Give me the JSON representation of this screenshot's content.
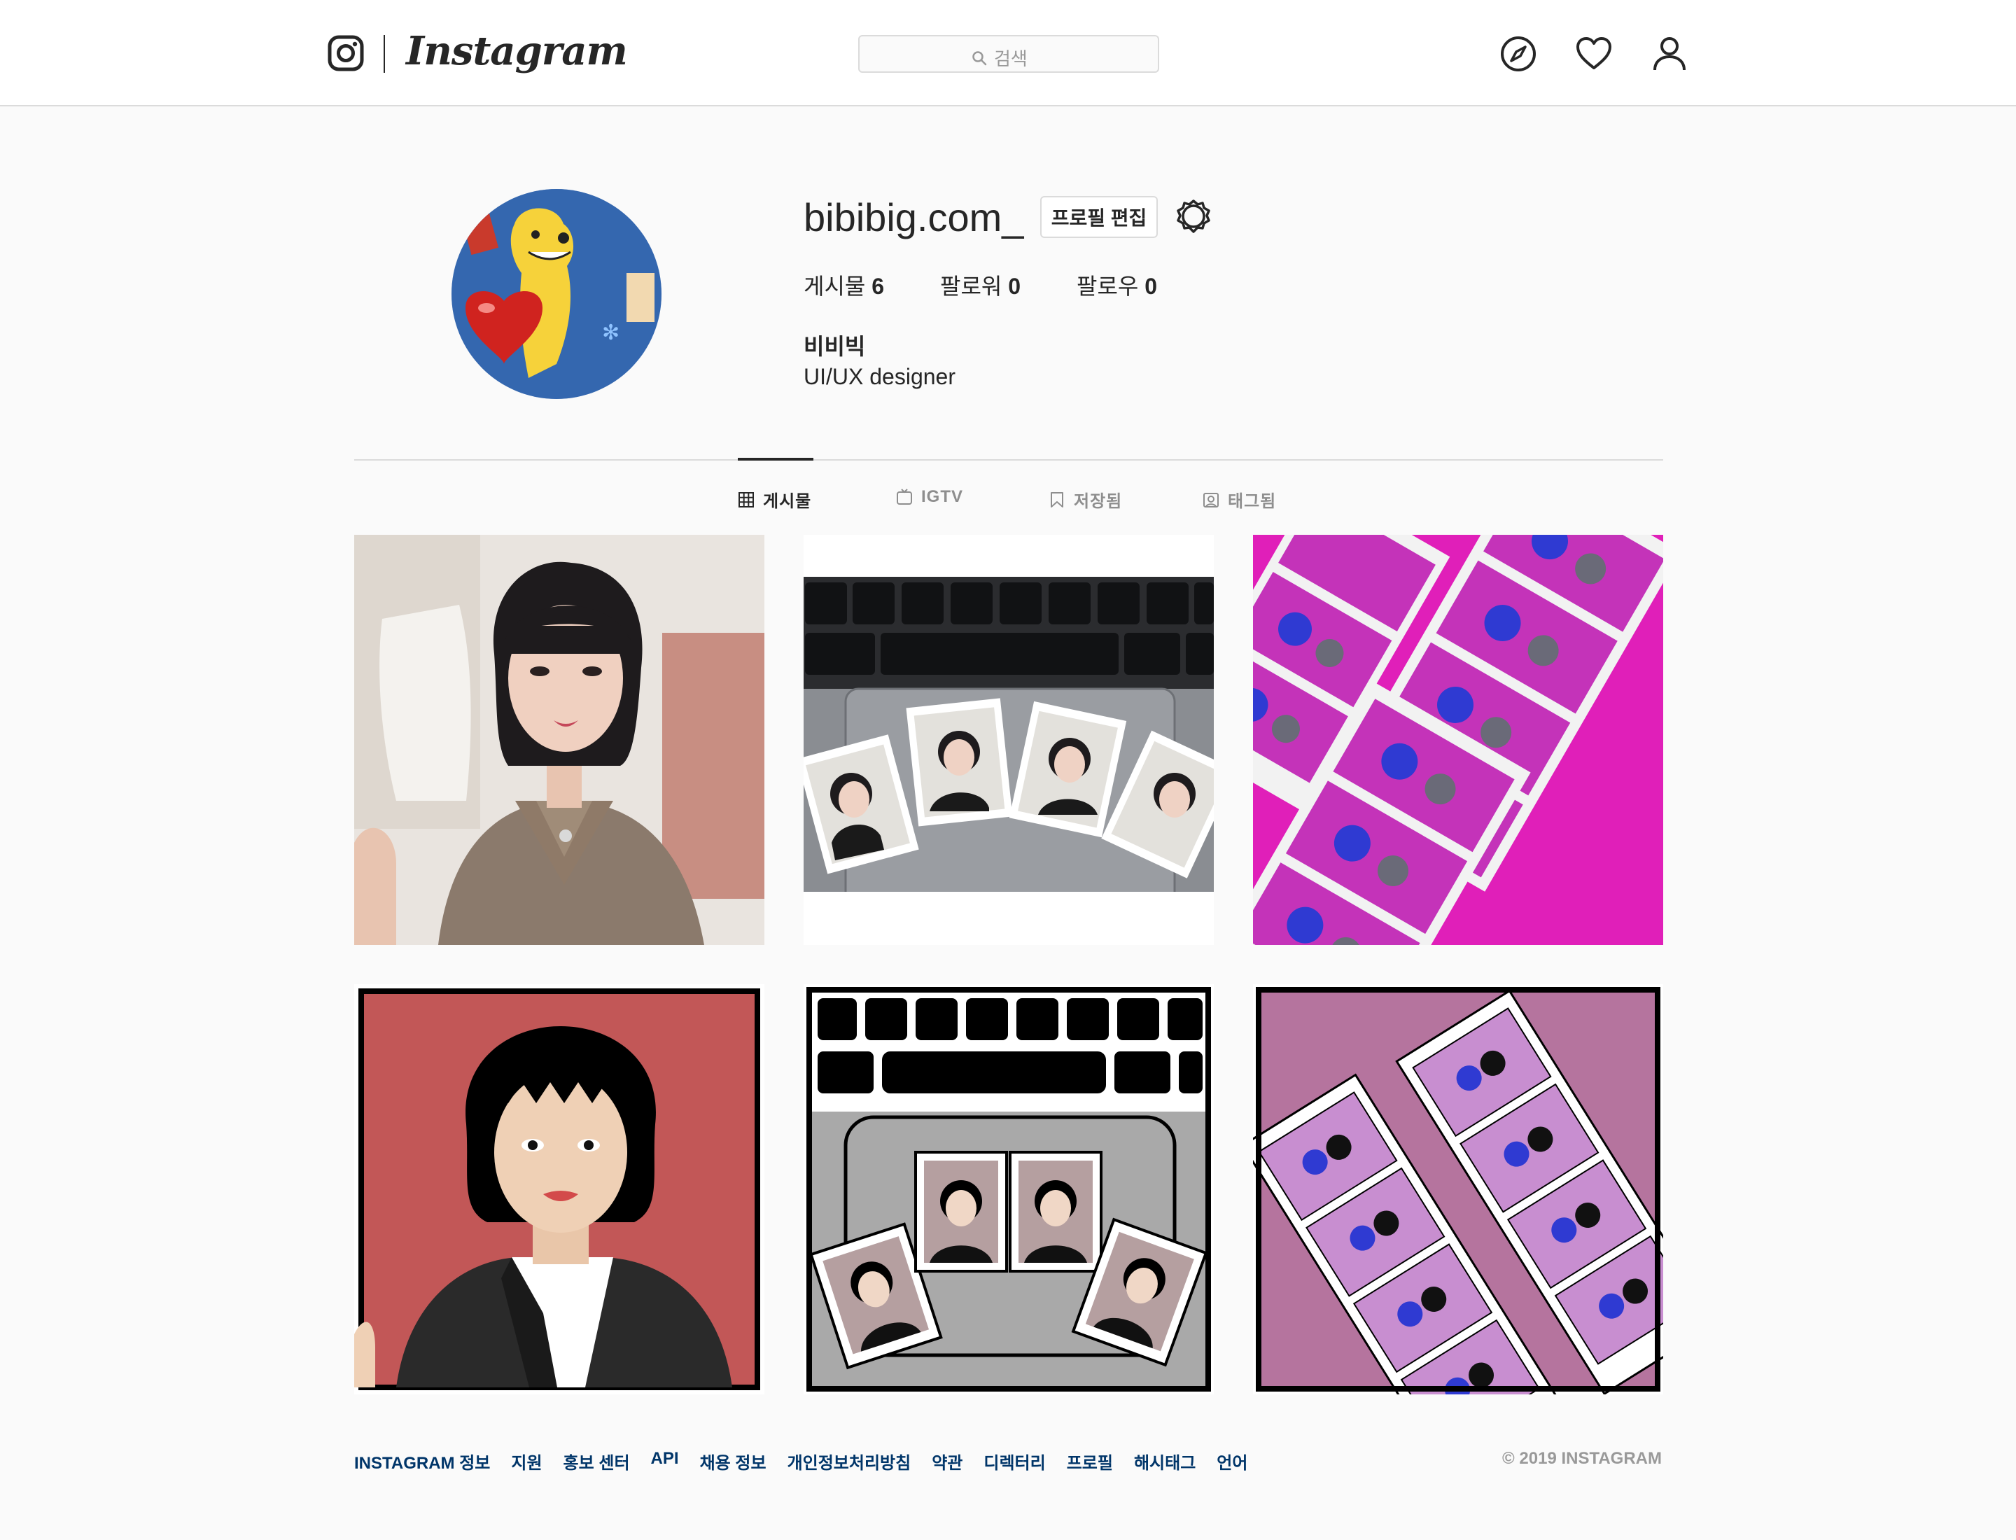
{
  "header": {
    "wordmark": "Instagram",
    "search_placeholder": "검색",
    "icons": [
      "instagram-logo-icon",
      "search-icon",
      "compass-icon",
      "heart-icon",
      "profile-icon"
    ]
  },
  "profile": {
    "username": "bibibig.com_",
    "edit_button": "프로필 편집",
    "stats": [
      {
        "label": "게시물",
        "value": "6"
      },
      {
        "label": "팔로워",
        "value": "0"
      },
      {
        "label": "팔로우",
        "value": "0"
      }
    ],
    "full_name": "비비빅",
    "bio": "UI/UX designer"
  },
  "tabs": [
    {
      "label": "게시물",
      "icon": "grid-icon",
      "active": true
    },
    {
      "label": "IGTV",
      "icon": "igtv-icon",
      "active": false
    },
    {
      "label": "저장됨",
      "icon": "bookmark-icon",
      "active": false
    },
    {
      "label": "태그됨",
      "icon": "tag-icon",
      "active": false
    }
  ],
  "posts": [
    {
      "subject": "selfie-photo"
    },
    {
      "subject": "keyboard-id-photos"
    },
    {
      "subject": "photo-booth-strips-pink"
    },
    {
      "subject": "illustrated-portrait"
    },
    {
      "subject": "illustrated-keyboard-id-photos"
    },
    {
      "subject": "illustrated-photo-strips"
    }
  ],
  "footer": {
    "links": [
      "INSTAGRAM 정보",
      "지원",
      "홍보 센터",
      "API",
      "채용 정보",
      "개인정보처리방침",
      "약관",
      "디렉터리",
      "프로필",
      "해시태그",
      "언어"
    ],
    "copyright": "© 2019 INSTAGRAM"
  },
  "colors": {
    "background": "#fafafa",
    "border": "#dbdbdb",
    "text": "#262626",
    "link": "#003569",
    "muted": "#8e8e8e"
  }
}
